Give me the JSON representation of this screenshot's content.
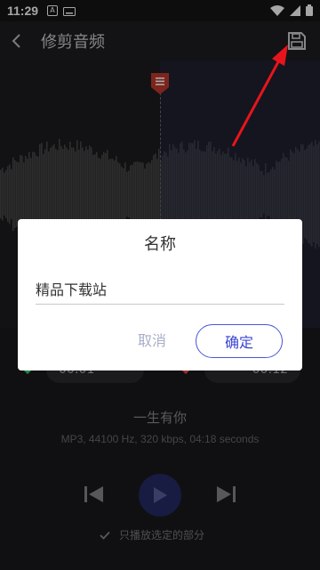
{
  "status_bar": {
    "time": "11:29",
    "icons": [
      "notification-a-icon",
      "keyboard-icon",
      "wifi-icon",
      "signal-icon",
      "battery-icon"
    ]
  },
  "app_bar": {
    "title": "修剪音频",
    "icons": [
      "back-arrow-icon",
      "save-icon"
    ]
  },
  "editor": {
    "start_time_partial": "00:01",
    "end_time_partial": "00:12",
    "marker_colors": {
      "start": "#2ecc71",
      "end": "#e74c3c",
      "top": "#c0392b"
    }
  },
  "track": {
    "title": "一生有你",
    "meta": "MP3, 44100 Hz, 320 kbps, 04:18 seconds"
  },
  "player": {
    "play_selected_only": "只播放选定的部分"
  },
  "dialog": {
    "title": "名称",
    "input_value": "精品下载站",
    "cancel": "取消",
    "confirm": "确定"
  },
  "colors": {
    "accent": "#3a45d0",
    "annotation_arrow": "#e8141c"
  }
}
